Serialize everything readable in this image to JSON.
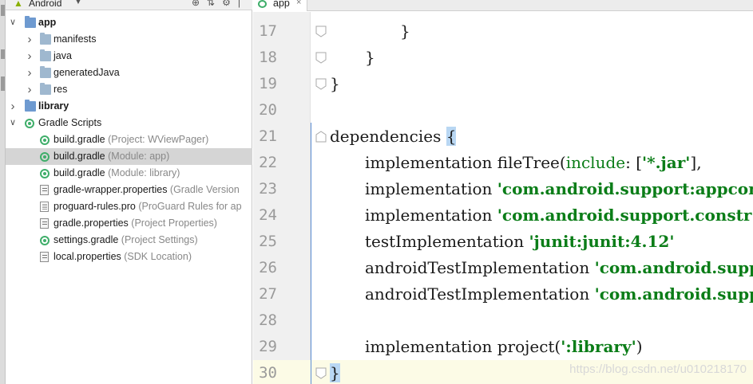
{
  "project_panel": {
    "view_title": "Android",
    "tree": [
      {
        "label": "app",
        "hint": "",
        "level": 0,
        "expanded": true,
        "icon": "module-folder-icon",
        "bold": true
      },
      {
        "label": "manifests",
        "hint": "",
        "level": 1,
        "expanded": false,
        "icon": "folder-icon",
        "bold": false
      },
      {
        "label": "java",
        "hint": "",
        "level": 1,
        "expanded": false,
        "icon": "folder-icon",
        "bold": false
      },
      {
        "label": "generatedJava",
        "hint": "",
        "level": 1,
        "expanded": false,
        "icon": "folder-icon",
        "bold": false
      },
      {
        "label": "res",
        "hint": "",
        "level": 1,
        "expanded": false,
        "icon": "folder-icon",
        "bold": false
      },
      {
        "label": "library",
        "hint": "",
        "level": 0,
        "expanded": false,
        "icon": "module-folder-icon",
        "bold": true
      },
      {
        "label": "Gradle Scripts",
        "hint": "",
        "level": 0,
        "expanded": true,
        "icon": "gradle-icon",
        "bold": false
      },
      {
        "label": "build.gradle",
        "hint": "(Project: WViewPager)",
        "level": 1,
        "icon": "gradle-icon",
        "bold": false,
        "selected": false
      },
      {
        "label": "build.gradle",
        "hint": "(Module: app)",
        "level": 1,
        "icon": "gradle-icon",
        "bold": false,
        "selected": true
      },
      {
        "label": "build.gradle",
        "hint": "(Module: library)",
        "level": 1,
        "icon": "gradle-icon",
        "bold": false,
        "selected": false
      },
      {
        "label": "gradle-wrapper.properties",
        "hint": "(Gradle Version",
        "level": 1,
        "icon": "properties-file-icon",
        "bold": false
      },
      {
        "label": "proguard-rules.pro",
        "hint": "(ProGuard Rules for ap",
        "level": 1,
        "icon": "text-file-icon",
        "bold": false
      },
      {
        "label": "gradle.properties",
        "hint": "(Project Properties)",
        "level": 1,
        "icon": "properties-file-icon",
        "bold": false
      },
      {
        "label": "settings.gradle",
        "hint": "(Project Settings)",
        "level": 1,
        "icon": "gradle-icon",
        "bold": false
      },
      {
        "label": "local.properties",
        "hint": "(SDK Location)",
        "level": 1,
        "icon": "properties-file-icon",
        "bold": false
      }
    ]
  },
  "editor": {
    "tab": {
      "label": "app",
      "close": "×"
    },
    "lines": [
      {
        "num": "17",
        "indent": 2,
        "parts": [
          {
            "t": "}",
            "c": ""
          }
        ],
        "fold": "end"
      },
      {
        "num": "18",
        "indent": 1,
        "parts": [
          {
            "t": "}",
            "c": ""
          }
        ],
        "fold": "end"
      },
      {
        "num": "19",
        "indent": 0,
        "parts": [
          {
            "t": "}",
            "c": ""
          }
        ],
        "fold": "end"
      },
      {
        "num": "20",
        "indent": 0,
        "parts": [],
        "fold": ""
      },
      {
        "num": "21",
        "indent": 0,
        "parts": [
          {
            "t": "dependencies ",
            "c": ""
          },
          {
            "t": "{",
            "c": "brace-hl"
          }
        ],
        "fold": "start"
      },
      {
        "num": "22",
        "indent": 1,
        "parts": [
          {
            "t": "implementation fileTree(",
            "c": ""
          },
          {
            "t": "include",
            "c": "kw"
          },
          {
            "t": ": [",
            "c": ""
          },
          {
            "t": "'*.jar'",
            "c": "str"
          },
          {
            "t": "], ",
            "c": ""
          }
        ],
        "fold": ""
      },
      {
        "num": "23",
        "indent": 1,
        "parts": [
          {
            "t": "implementation ",
            "c": ""
          },
          {
            "t": "'com.android.support:appcom",
            "c": "str"
          }
        ],
        "fold": ""
      },
      {
        "num": "24",
        "indent": 1,
        "parts": [
          {
            "t": "implementation ",
            "c": ""
          },
          {
            "t": "'com.android.support.constr",
            "c": "str"
          }
        ],
        "fold": ""
      },
      {
        "num": "25",
        "indent": 1,
        "parts": [
          {
            "t": "testImplementation ",
            "c": ""
          },
          {
            "t": "'junit:junit:4.12'",
            "c": "str"
          }
        ],
        "fold": ""
      },
      {
        "num": "26",
        "indent": 1,
        "parts": [
          {
            "t": "androidTestImplementation ",
            "c": ""
          },
          {
            "t": "'com.android.supp",
            "c": "str"
          }
        ],
        "fold": ""
      },
      {
        "num": "27",
        "indent": 1,
        "parts": [
          {
            "t": "androidTestImplementation ",
            "c": ""
          },
          {
            "t": "'com.android.supp",
            "c": "str"
          }
        ],
        "fold": ""
      },
      {
        "num": "28",
        "indent": 0,
        "parts": [],
        "fold": ""
      },
      {
        "num": "29",
        "indent": 1,
        "parts": [
          {
            "t": "implementation project(",
            "c": ""
          },
          {
            "t": "':library'",
            "c": "str"
          },
          {
            "t": ")",
            "c": ""
          }
        ],
        "fold": ""
      },
      {
        "num": "30",
        "indent": 0,
        "parts": [
          {
            "t": "}",
            "c": "brace-hl"
          }
        ],
        "fold": "end",
        "current": true
      }
    ]
  },
  "watermark": "https://blog.csdn.net/u010218170",
  "colors": {
    "string": "#0b7d18",
    "brace_highlight": "#b9d7f3",
    "current_line": "#fcfbe6",
    "selection": "#d5d5d5",
    "gradle": "#3fae6a"
  }
}
